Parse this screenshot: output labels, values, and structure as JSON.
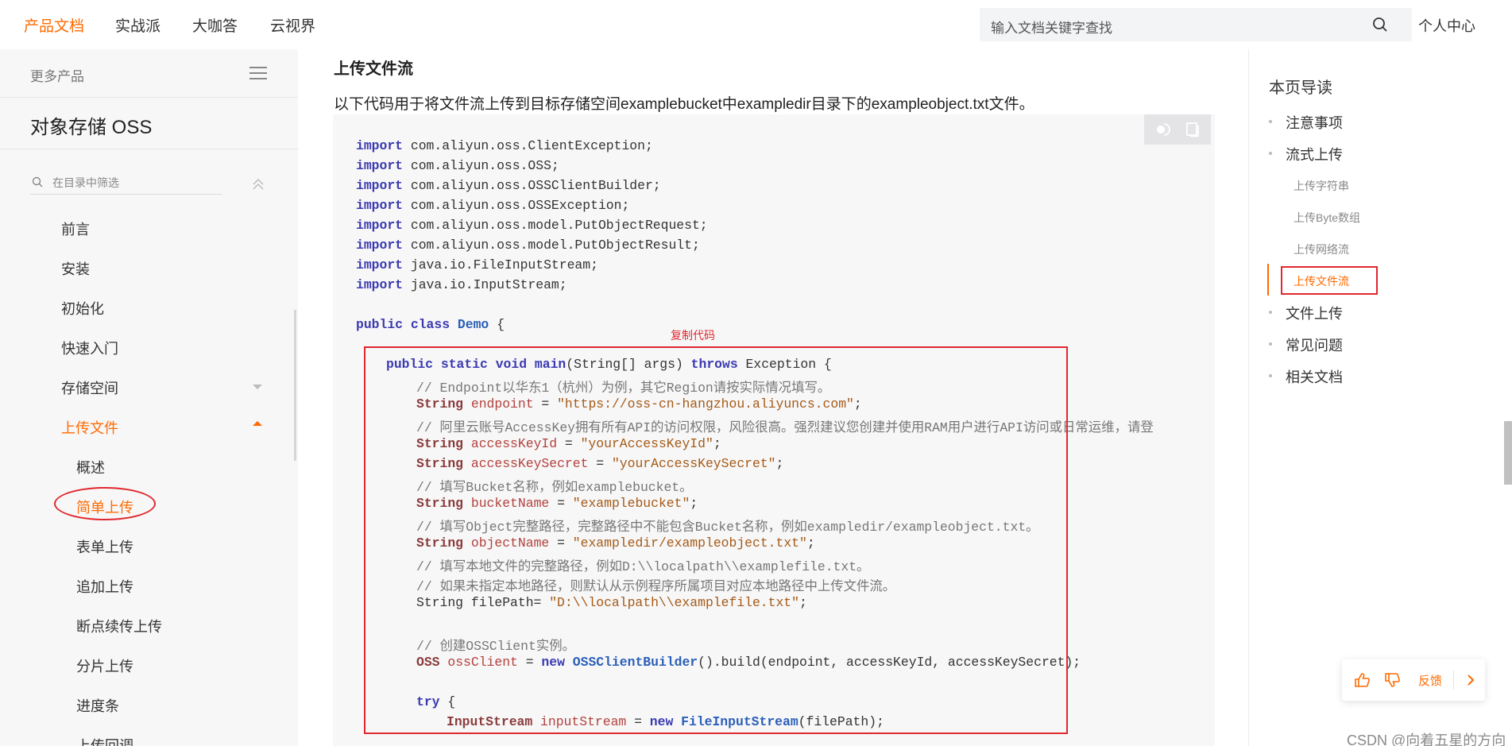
{
  "topnav": {
    "items": [
      "产品文档",
      "实战派",
      "大咖答",
      "云视界"
    ],
    "search_placeholder": "输入文档关键字查找",
    "personal_center": "个人中心"
  },
  "sidebar": {
    "more_products": "更多产品",
    "product_name": "对象存储 OSS",
    "filter_placeholder": "在目录中筛选",
    "items": [
      "前言",
      "安装",
      "初始化",
      "快速入门",
      "存储空间",
      "上传文件"
    ],
    "sub_items": [
      "概述",
      "简单上传",
      "表单上传",
      "追加上传",
      "断点续传上传",
      "分片上传",
      "进度条",
      "上传回调"
    ]
  },
  "content": {
    "section_title": "上传文件流",
    "intro": "以下代码用于将文件流上传到目标存储空间examplebucket中exampledir目录下的exampleobject.txt文件。",
    "copy_label": "复制代码",
    "imports": [
      "com.aliyun.oss.ClientException;",
      "com.aliyun.oss.OSS;",
      "com.aliyun.oss.OSSClientBuilder;",
      "com.aliyun.oss.OSSException;",
      "com.aliyun.oss.model.PutObjectRequest;",
      "com.aliyun.oss.model.PutObjectResult;",
      "java.io.FileInputStream;",
      "java.io.InputStream;"
    ],
    "import_kw": "import",
    "class_decl": {
      "kw": "public class",
      "name": "Demo",
      "rest": " {"
    },
    "main_decl": {
      "kw1": "public static void",
      "name": "main",
      "args": "(String[] args) ",
      "kw2": "throws",
      "rest": " Exception {"
    },
    "comment1": "// Endpoint以华东1（杭州）为例，其它Region请按实际情况填写。",
    "endpoint": {
      "type": "String",
      "name": "endpoint",
      "value": "\"https://oss-cn-hangzhou.aliyuncs.com\""
    },
    "comment2": "// 阿里云账号AccessKey拥有所有API的访问权限，风险很高。强烈建议您创建并使用RAM用户进行API访问或日常运维，请登",
    "access_key_id": {
      "type": "String",
      "name": "accessKeyId",
      "value": "\"yourAccessKeyId\""
    },
    "access_key_secret": {
      "type": "String",
      "name": "accessKeySecret",
      "value": "\"yourAccessKeySecret\""
    },
    "comment3": "// 填写Bucket名称，例如examplebucket。",
    "bucket_name": {
      "type": "String",
      "name": "bucketName",
      "value": "\"examplebucket\""
    },
    "comment4": "// 填写Object完整路径，完整路径中不能包含Bucket名称，例如exampledir/exampleobject.txt。",
    "object_name": {
      "type": "String",
      "name": "objectName",
      "value": "\"exampledir/exampleobject.txt\""
    },
    "comment5": "// 填写本地文件的完整路径，例如D:\\\\localpath\\\\examplefile.txt。",
    "comment6": "// 如果未指定本地路径，则默认从示例程序所属项目对应本地路径中上传文件流。",
    "file_path_plain": "String filePath= ",
    "file_path_value": "\"D:\\\\localpath\\\\examplefile.txt\"",
    "comment7": "// 创建OSSClient实例。",
    "oss_client": {
      "type": "OSS",
      "name": "ossClient",
      "eq": " = ",
      "kw": "new",
      "cls": "OSSClientBuilder",
      "rest": "().build(endpoint, accessKeyId, accessKeySecret);"
    },
    "try_kw": "try",
    "input_stream": {
      "type": "InputStream",
      "name": "inputStream",
      "kw": "new",
      "cls": "FileInputStream",
      "rest": "(filePath);"
    }
  },
  "toc": {
    "title": "本页导读",
    "items": [
      "注意事项",
      "流式上传",
      "文件上传",
      "常见问题",
      "相关文档"
    ],
    "sub_items": [
      "上传字符串",
      "上传Byte数组",
      "上传网络流",
      "上传文件流"
    ]
  },
  "feedback": {
    "label": "反馈"
  },
  "watermark": "CSDN @向着五星的方向",
  "colors": {
    "accent": "#ff6a00",
    "annotation_red": "#e0282e"
  }
}
